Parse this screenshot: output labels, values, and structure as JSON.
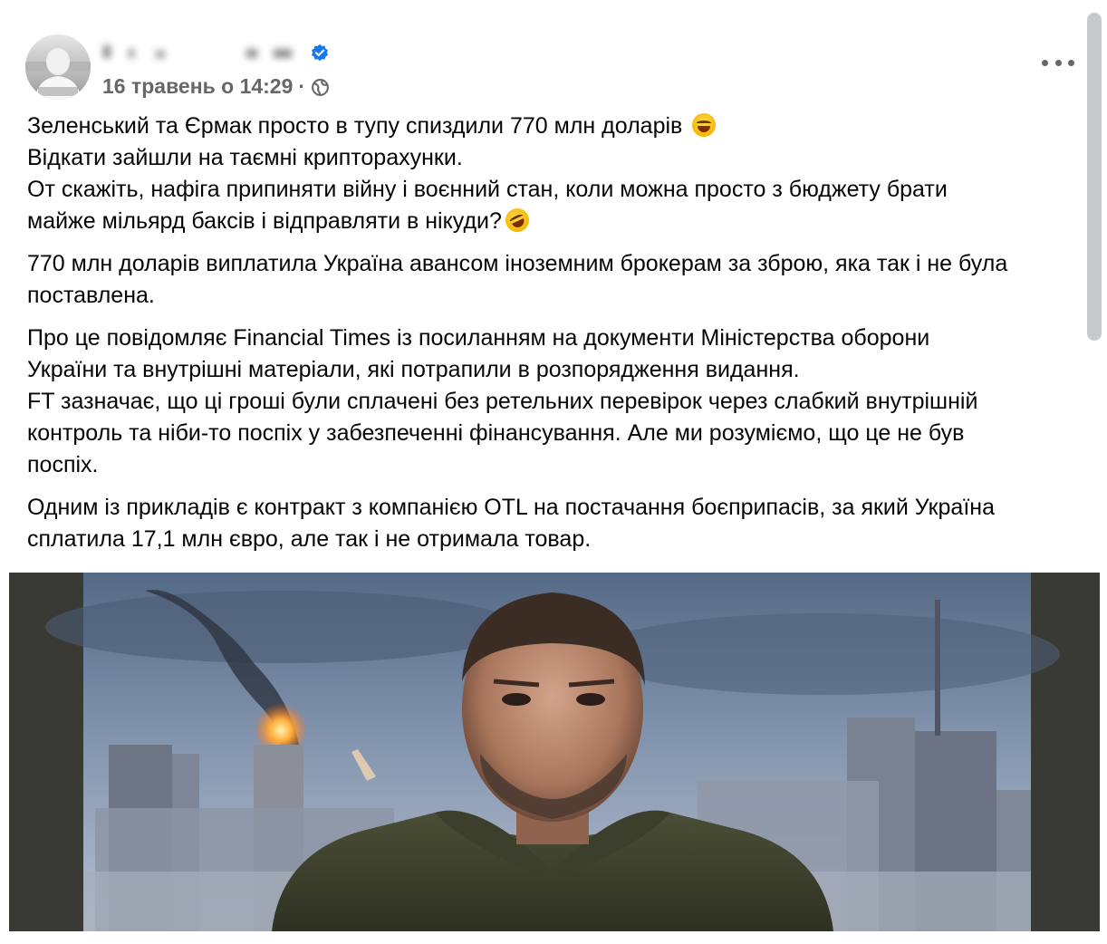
{
  "post": {
    "author_name": "",
    "timestamp": "16 травень о 14:29",
    "separator": "·",
    "paragraphs": [
      {
        "lines": [
          "Зеленський та Єрмак просто в тупу спиздили 770 млн доларів",
          "Відкати зайшли на таємні крипторахунки.",
          "От скажіть, нафіга припиняти війну і воєнний стан, коли можна просто з бюджету брати",
          "майже мільярд баксів і відправляти в нікуди?"
        ]
      },
      {
        "lines": [
          "770 млн доларів виплатила Україна авансом іноземним брокерам за зброю, яка так і не була",
          "поставлена."
        ]
      },
      {
        "lines": [
          "Про це повідомляє Financial Times із посиланням на документи Міністерства оборони",
          "України та внутрішні матеріали, які потрапили в розпорядження видання.",
          "FT зазначає, що ці гроші були сплачені без ретельних перевірок через слабкий внутрішній",
          "контроль та ніби-то поспіх у забезпеченні фінансування. Але ми розуміємо, що це не був",
          "поспіх."
        ]
      },
      {
        "lines": [
          "Одним із прикладів є контракт з компанією OTL на постачання боєприпасів, за який Україна",
          "сплатила 17,1 млн євро, але так і не отримала товар."
        ]
      }
    ],
    "icons": {
      "verified": "verified-badge-icon",
      "audience": "globe-icon",
      "menu": "more-options-icon",
      "emoji_1": "laughing-tears-emoji",
      "emoji_2": "rolling-laughing-emoji"
    },
    "colors": {
      "text": "#050505",
      "meta": "#65676b",
      "verified": "#1877f2"
    }
  }
}
